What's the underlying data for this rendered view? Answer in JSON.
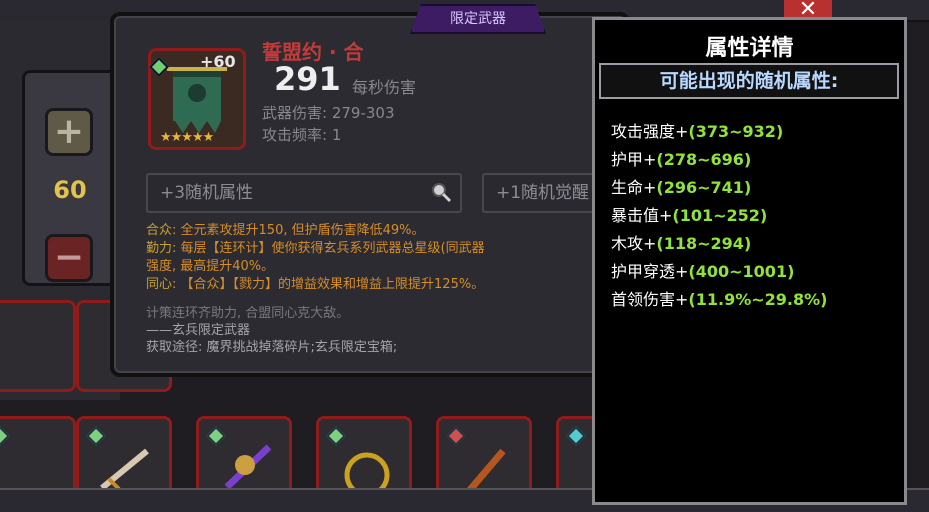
{
  "background": {
    "stepper_value": "60",
    "stepper_plus": "+",
    "stepper_minus": "−"
  },
  "popup": {
    "limited_badge": "限定武器",
    "weapon_name": "誓盟约 · 合",
    "level": "+60",
    "stars": "★★★★★",
    "dps_value": "291",
    "dps_label": "每秒伤害",
    "weapon_damage": "武器伤害: 279-303",
    "attack_rate": "攻击频率: 1",
    "random_attr_box": "+3随机属性",
    "random_awaken_box": "+1随机觉醒",
    "effects": [
      {
        "key": "合众",
        "text": ": 全元素攻提升150, 但护盾伤害降低49%。"
      },
      {
        "key": "勤力",
        "text": ": 每层【连环计】使你获得玄兵系列武器总星级(同武器"
      },
      {
        "key": "",
        "text": "强度, 最高提升40%。"
      },
      {
        "key": "同心",
        "text": ": 【合众】【戮力】的增益效果和增益上限提升125%。"
      }
    ],
    "lore_1": "计策连环齐助力, 合盟同心克大敌。",
    "lore_2": "——玄兵限定武器",
    "lore_3": "获取途径: 魔界挑战掉落碎片;玄兵限定宝箱;",
    "icons": {
      "weapon": "banner-weapon-icon",
      "search_1": "magnifier-icon",
      "search_2": "magnifier-icon"
    }
  },
  "detail_panel": {
    "title": "属性详情",
    "subtitle": "可能出现的随机属性:",
    "close_icon": "close-icon",
    "stats": [
      {
        "name": "攻击强度+",
        "range": "(373~932)"
      },
      {
        "name": "护甲+",
        "range": "(278~696)"
      },
      {
        "name": "生命+",
        "range": "(296~741)"
      },
      {
        "name": "暴击值+",
        "range": "(101~252)"
      },
      {
        "name": "木攻+",
        "range": "(118~294)"
      },
      {
        "name": "护甲穿透+",
        "range": "(400~1001)"
      },
      {
        "name": "首领伤害+",
        "range": "(11.9%~29.8%)"
      }
    ]
  },
  "colors": {
    "rarity_border": "#8f1b1b",
    "effect_text": "#d68d2a",
    "stat_range": "#8fe33b",
    "weapon_name": "#c23b3b"
  }
}
